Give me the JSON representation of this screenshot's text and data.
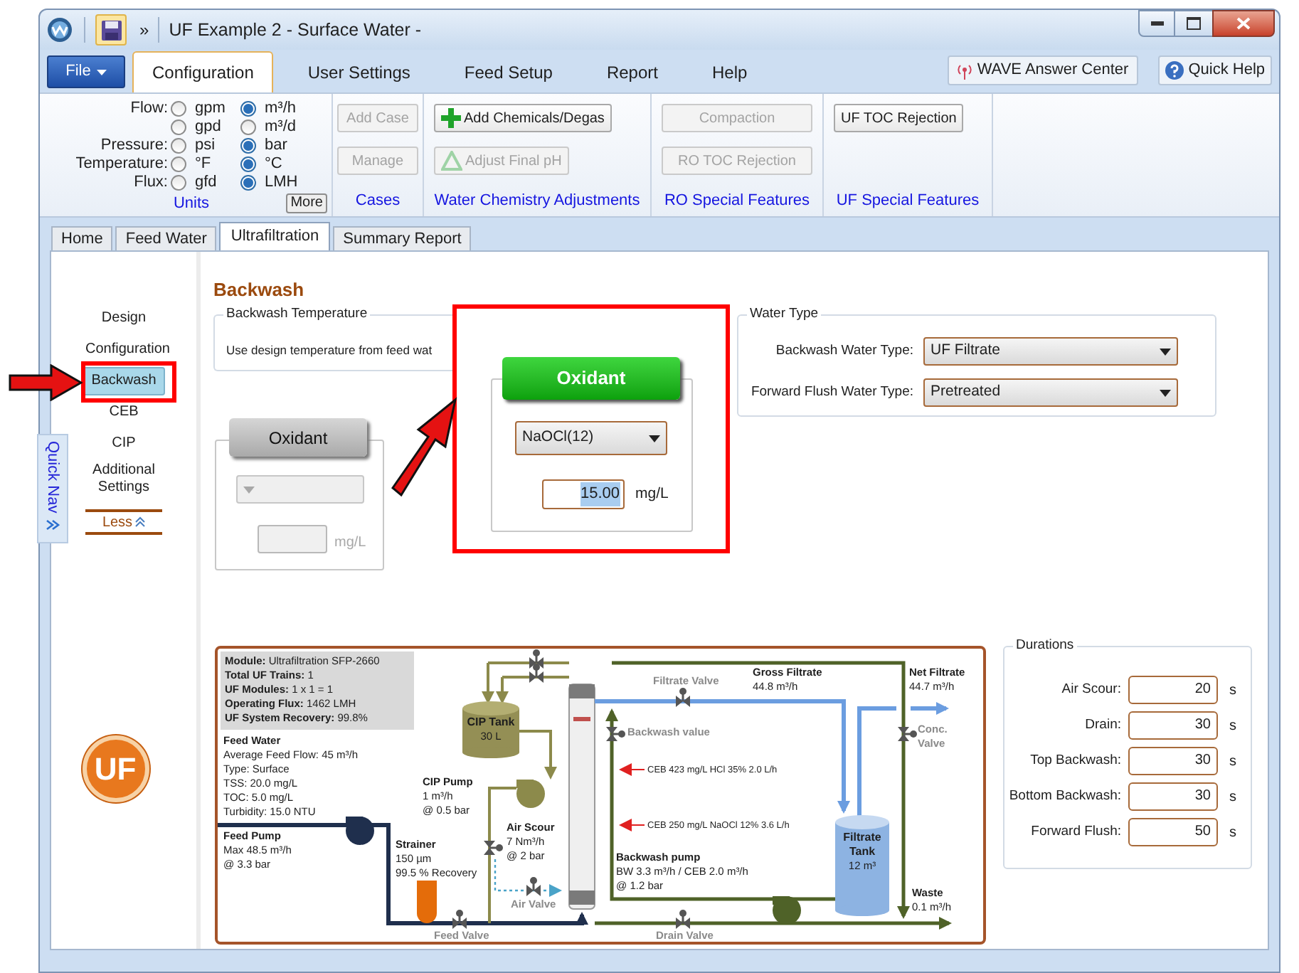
{
  "window": {
    "title": "UF Example 2 - Surface Water -",
    "quick_access": "»"
  },
  "menu": {
    "file": "File",
    "tabs": [
      {
        "label": "Configuration",
        "selected": true
      },
      {
        "label": "User Settings",
        "selected": false
      },
      {
        "label": "Feed Setup",
        "selected": false
      },
      {
        "label": "Report",
        "selected": false
      },
      {
        "label": "Help",
        "selected": false
      }
    ],
    "answer_center": "WAVE Answer Center",
    "quick_help": "Quick Help"
  },
  "ribbon": {
    "units": {
      "label": "Units",
      "more": "More",
      "rows": [
        {
          "label": "Flow:",
          "options": [
            {
              "text": "gpm",
              "selected": false
            },
            {
              "text": "m³/h",
              "selected": true
            }
          ]
        },
        {
          "options": [
            {
              "text": "gpd",
              "selected": false
            },
            {
              "text": "m³/d",
              "selected": false
            }
          ]
        },
        {
          "label": "Pressure:",
          "options": [
            {
              "text": "psi",
              "selected": false
            },
            {
              "text": "bar",
              "selected": true
            }
          ]
        },
        {
          "label": "Temperature:",
          "options": [
            {
              "text": "°F",
              "selected": false
            },
            {
              "text": "°C",
              "selected": true
            }
          ]
        },
        {
          "label": "Flux:",
          "options": [
            {
              "text": "gfd",
              "selected": false
            },
            {
              "text": "LMH",
              "selected": true
            }
          ]
        }
      ]
    },
    "groups": [
      {
        "label": "Cases",
        "buttons": [
          {
            "text": "Add Case",
            "kind": "plain",
            "disabled": true
          },
          {
            "text": "Manage",
            "kind": "plain",
            "disabled": true
          }
        ]
      },
      {
        "label": "Water Chemistry Adjustments",
        "buttons": [
          {
            "text": "Add Chemicals/Degas",
            "kind": "add",
            "disabled": false
          },
          {
            "text": "Adjust Final pH",
            "kind": "adjust",
            "disabled": true
          }
        ]
      },
      {
        "label": "RO Special Features",
        "buttons": [
          {
            "text": "Compaction",
            "kind": "plain",
            "disabled": true
          },
          {
            "text": "RO TOC Rejection",
            "kind": "plain",
            "disabled": true
          }
        ]
      },
      {
        "label": "UF Special Features",
        "buttons": [
          {
            "text": "UF TOC Rejection",
            "kind": "plain",
            "disabled": false
          }
        ]
      }
    ]
  },
  "subtabs": [
    {
      "label": "Home",
      "selected": false
    },
    {
      "label": "Feed Water",
      "selected": false
    },
    {
      "label": "Ultrafiltration",
      "selected": true
    },
    {
      "label": "Summary Report",
      "selected": false
    }
  ],
  "quick_nav": "Quick Nav",
  "nav": {
    "items": [
      {
        "label": "Design",
        "selected": false
      },
      {
        "label": "Configuration",
        "selected": false
      },
      {
        "label": "Backwash",
        "selected": true
      },
      {
        "label": "CEB",
        "selected": false
      },
      {
        "label": "CIP",
        "selected": false
      },
      {
        "label": "Additional Settings",
        "selected": false
      }
    ],
    "less": "Less"
  },
  "logo": "UF",
  "page": {
    "title": "Backwash",
    "backwash_temperature": {
      "legend": "Backwash Temperature",
      "text": "Use design temperature from feed wat"
    },
    "oxidant_groups": [
      {
        "button": "Oxidant",
        "active": false,
        "unit": "mg/L"
      },
      {
        "button": "Oxidant",
        "active": true,
        "chemical": "NaOCl(12)",
        "dose": "15.00",
        "dose_selected": true,
        "unit": "mg/L"
      }
    ],
    "water_type": {
      "legend": "Water Type",
      "fields": [
        {
          "label": "Backwash Water Type:",
          "value": "UF Filtrate"
        },
        {
          "label": "Forward Flush Water Type:",
          "value": "Pretreated"
        }
      ]
    },
    "durations": {
      "legend": "Durations",
      "rows": [
        {
          "label": "Air Scour:",
          "value": "20",
          "unit": "s"
        },
        {
          "label": "Drain:",
          "value": "30",
          "unit": "s"
        },
        {
          "label": "Top Backwash:",
          "value": "30",
          "unit": "s"
        },
        {
          "label": "Bottom Backwash:",
          "value": "30",
          "unit": "s"
        },
        {
          "label": "Forward Flush:",
          "value": "50",
          "unit": "s"
        }
      ]
    },
    "diagram": {
      "labels": [
        {
          "kind": "info",
          "lines": [
            "**Module:** Ultrafiltration SFP-2660",
            "**Total UF Trains:** 1",
            "**UF Modules:** 1 x 1 = 1",
            "**Operating Flux:** 1462 LMH",
            "**UF System Recovery:** 99.8%"
          ]
        },
        {
          "kind": "note",
          "title": "Feed Water",
          "lines": [
            "Average Feed Flow: 45 m³/h",
            "Type: Surface",
            "TSS: 20.0 mg/L",
            "TOC: 5.0 mg/L",
            "Turbidity: 15.0 NTU"
          ]
        },
        {
          "kind": "note",
          "title": "Feed Pump",
          "lines": [
            "Max 48.5 m³/h",
            "@ 3.3 bar"
          ]
        },
        {
          "kind": "note",
          "title": "CIP Pump",
          "lines": [
            "1 m³/h",
            "@ 0.5 bar"
          ]
        },
        {
          "kind": "tank",
          "title": "CIP Tank",
          "lines": [
            "30 L"
          ]
        },
        {
          "kind": "note",
          "title": "Strainer",
          "lines": [
            "150 µm",
            "99.5 % Recovery"
          ]
        },
        {
          "kind": "note",
          "title": "Air Scour",
          "lines": [
            "7 Nm³/h",
            "@ 2 bar"
          ]
        },
        {
          "kind": "valve",
          "title": "Air Valve"
        },
        {
          "kind": "valve",
          "title": "Feed Valve"
        },
        {
          "kind": "valve",
          "title": "Filtrate Valve"
        },
        {
          "kind": "valve",
          "title": "Backwash value"
        },
        {
          "kind": "note",
          "title": "Gross Filtrate",
          "lines": [
            "44.8 m³/h"
          ]
        },
        {
          "kind": "note",
          "title": "Net Filtrate",
          "lines": [
            "44.7 m³/h"
          ]
        },
        {
          "kind": "valve",
          "title": "Conc. Valve"
        },
        {
          "kind": "chem",
          "title": "CEB 423 mg/L HCl 35% 2.0 L/h"
        },
        {
          "kind": "chem",
          "title": "CEB 250 mg/L NaOCl 12% 3.6 L/h"
        },
        {
          "kind": "note",
          "title": "Backwash pump",
          "lines": [
            "BW 3.3 m³/h / CEB 2.0 m³/h",
            "@ 1.2 bar"
          ]
        },
        {
          "kind": "tank",
          "title": "Filtrate Tank",
          "lines": [
            "12 m³"
          ]
        },
        {
          "kind": "note",
          "title": "Waste",
          "lines": [
            "0.1 m³/h"
          ]
        },
        {
          "kind": "valve",
          "title": "Drain Valve"
        }
      ]
    }
  }
}
